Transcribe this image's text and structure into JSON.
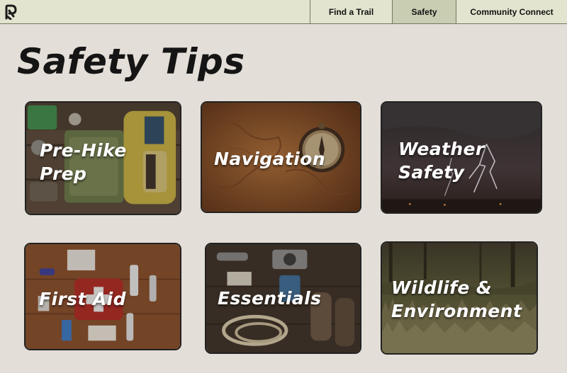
{
  "nav": {
    "items": [
      {
        "label": "Find a Trail"
      },
      {
        "label": "Safety"
      },
      {
        "label": "Community Connect"
      }
    ],
    "active": "Safety"
  },
  "page": {
    "title": "Safety Tips"
  },
  "cards": [
    {
      "label": "Pre-Hike\nPrep"
    },
    {
      "label": "Navigation"
    },
    {
      "label": "Weather\nSafety"
    },
    {
      "label": "First Aid"
    },
    {
      "label": "Essentials"
    },
    {
      "label": "Wildlife &\nEnvironment"
    }
  ]
}
